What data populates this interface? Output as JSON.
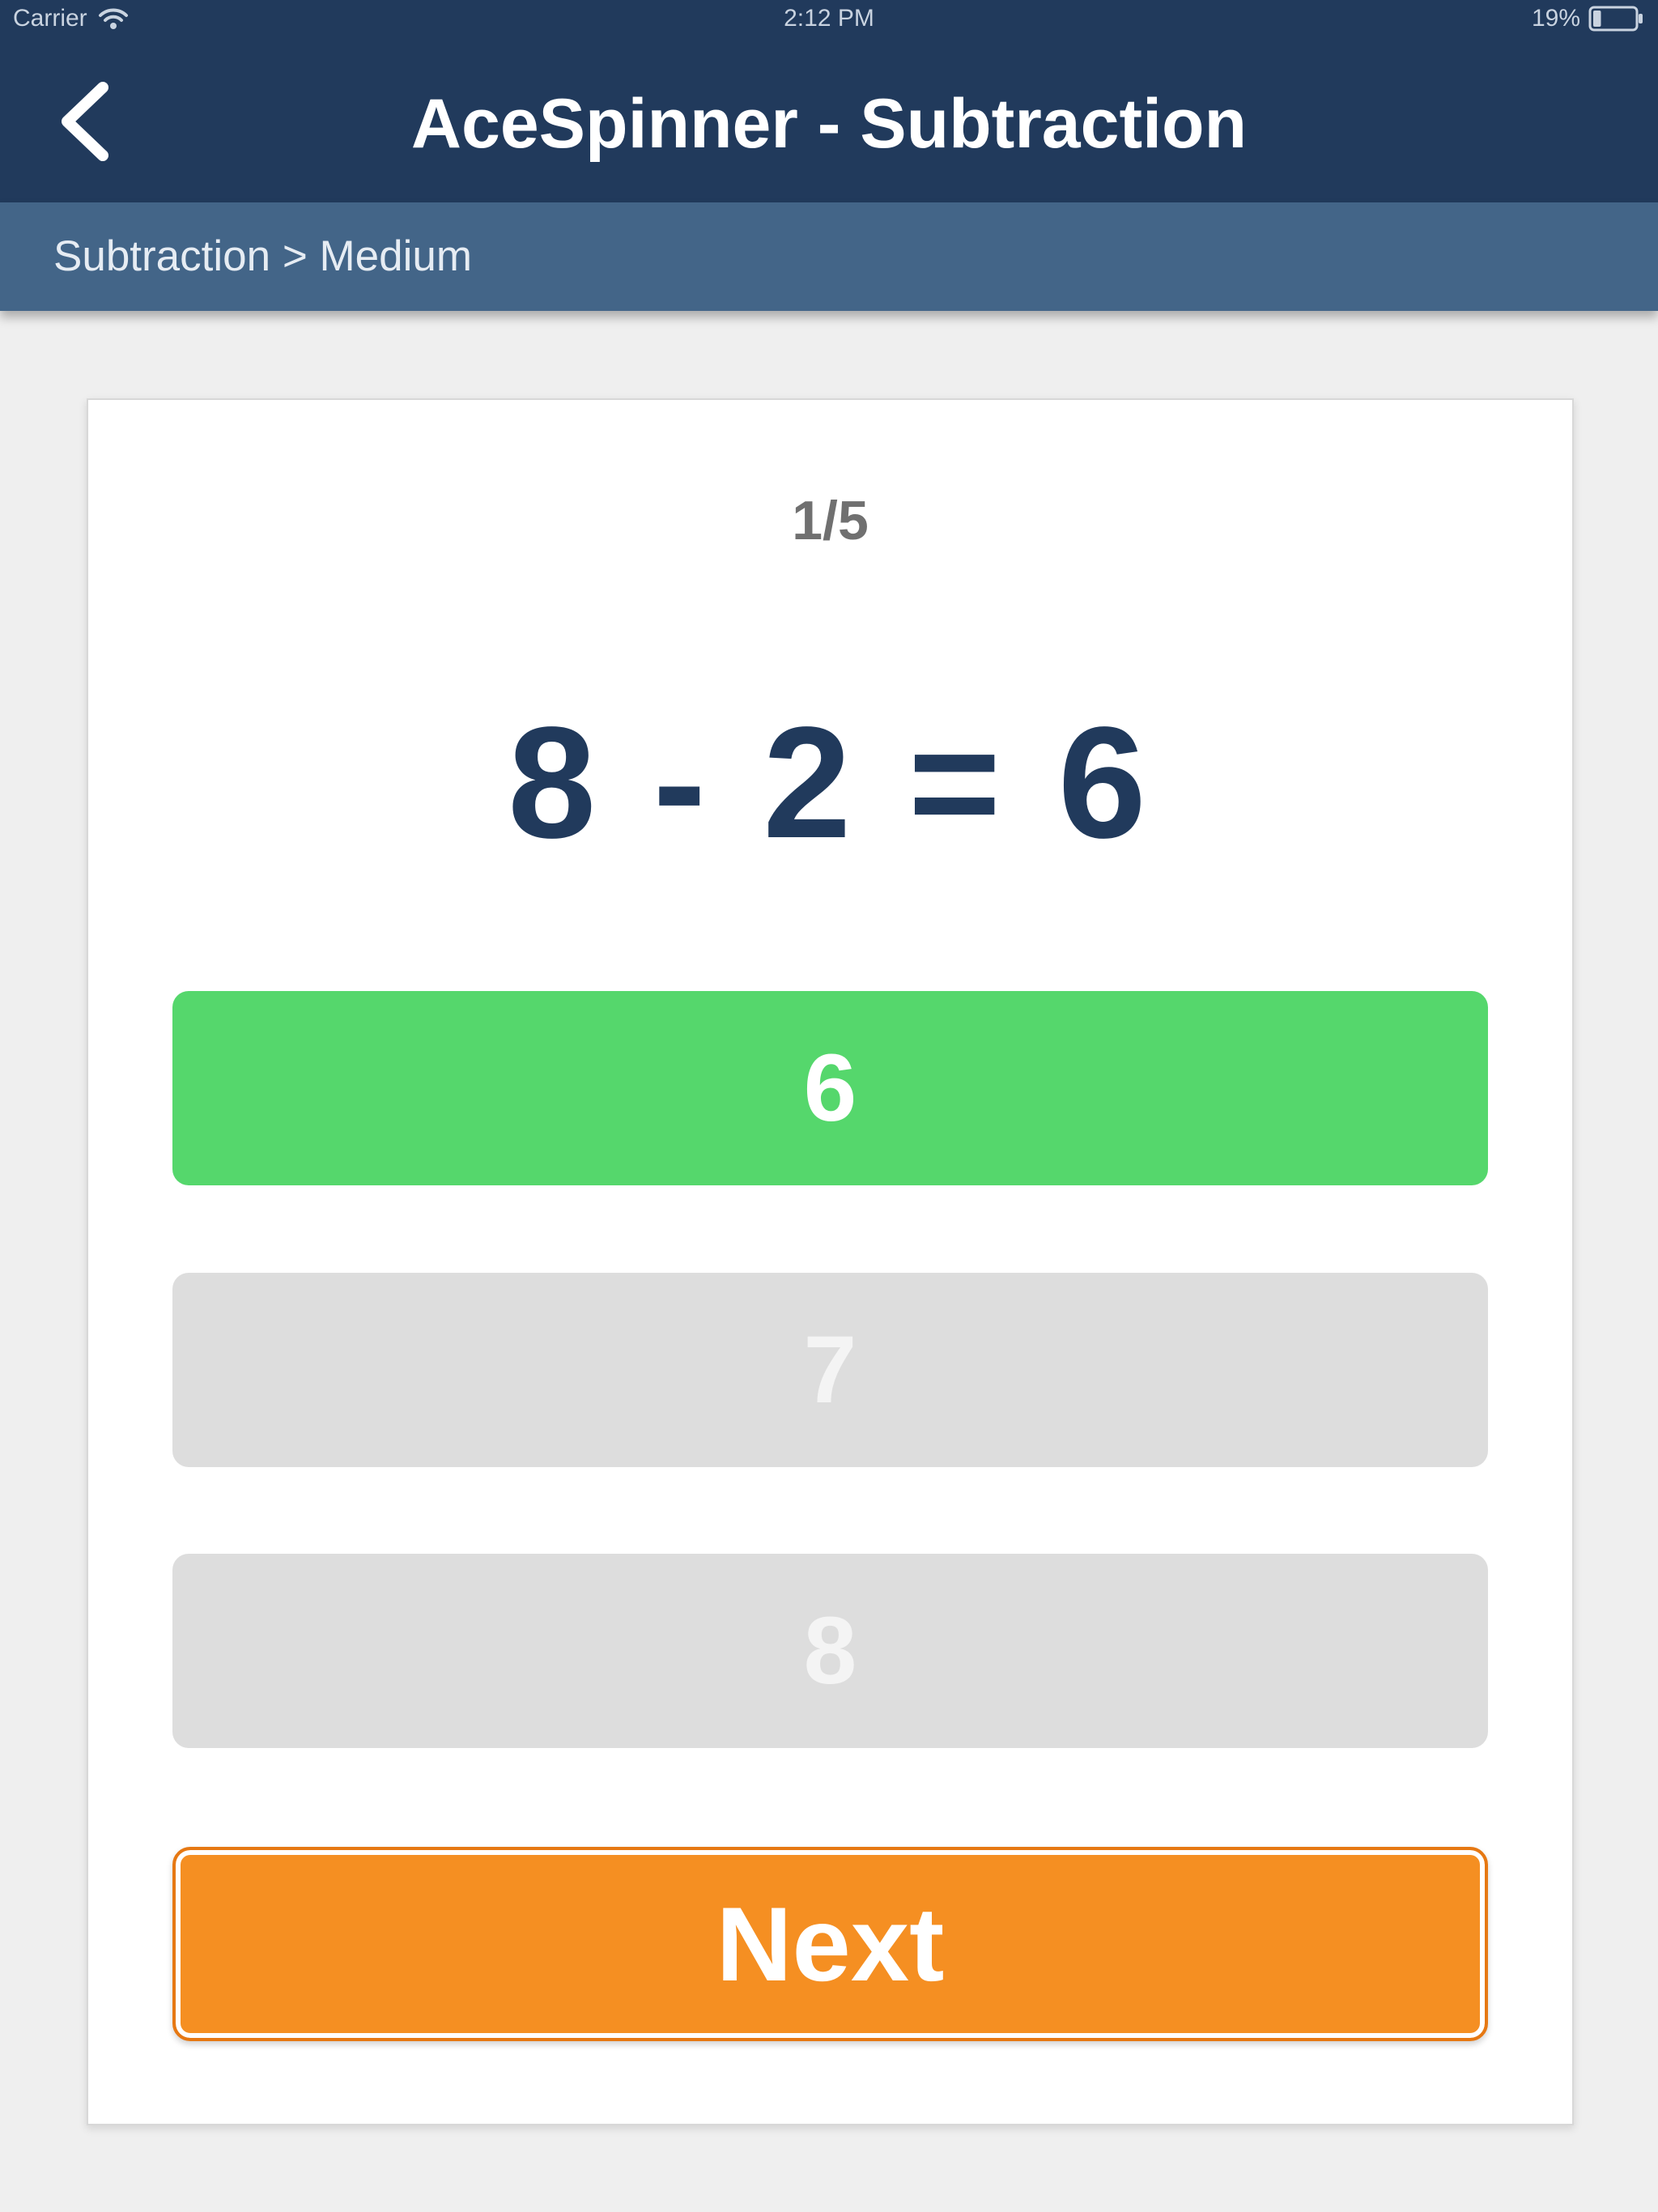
{
  "status_bar": {
    "carrier": "Carrier",
    "time": "2:12 PM",
    "battery_percent": "19%",
    "battery_level": 0.19
  },
  "nav": {
    "title": "AceSpinner - Subtraction",
    "back_icon": "chevron-left-icon"
  },
  "breadcrumb": {
    "text": "Subtraction > Medium"
  },
  "quiz": {
    "progress": "1/5",
    "equation": "8 - 2 = 6",
    "answers": [
      {
        "label": "6",
        "state": "correct"
      },
      {
        "label": "7",
        "state": "disabled"
      },
      {
        "label": "8",
        "state": "disabled"
      }
    ],
    "next_label": "Next"
  },
  "colors": {
    "nav_background": "#213a5c",
    "breadcrumb_background": "#436588",
    "correct_answer": "#55d76c",
    "disabled_answer": "#dddddd",
    "next_button": "#f58f22"
  }
}
